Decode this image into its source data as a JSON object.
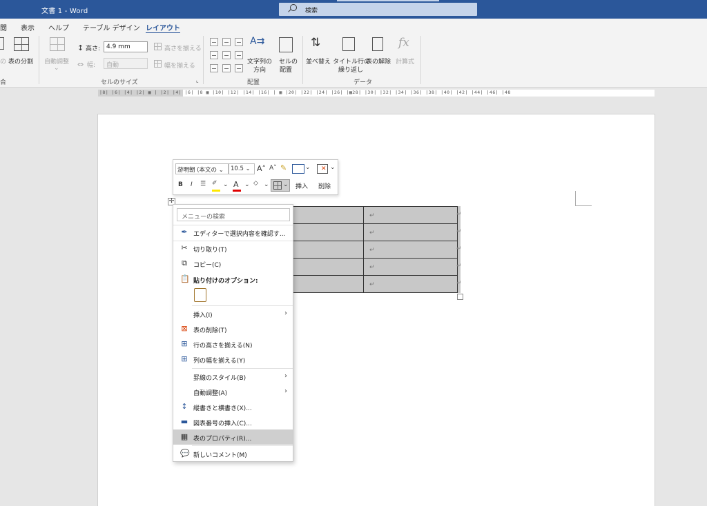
{
  "titlebar": {
    "doc_title": "文書 1  -  Word",
    "search_placeholder": "検索"
  },
  "tabs": [
    "閲",
    "表示",
    "ヘルプ",
    "テーブル デザイン",
    "レイアウト"
  ],
  "ribbon": {
    "partial_left_label": "の",
    "split_table": "表の分割",
    "autofit": "自動調整",
    "height_label": "高さ:",
    "height_value": "4.9 mm",
    "width_label": "幅:",
    "width_value": "自動",
    "distribute_rows": "高さを揃える",
    "distribute_cols": "幅を揃える",
    "text_direction_1": "文字列の",
    "text_direction_2": "方向",
    "cell_margins_1": "セルの",
    "cell_margins_2": "配置",
    "sort": "並べ替え",
    "repeat_header_1": "タイトル行の",
    "repeat_header_2": "繰り返し",
    "convert_to_text": "表の解除",
    "formula": "計算式",
    "group_merge": "合",
    "group_cell_size": "セルのサイズ",
    "group_alignment": "配置",
    "group_data": "データ"
  },
  "ruler": {
    "numbers": "|8| |6| |4| |2| ▦ | |2| |4| |6| |8 ▦ |10| |12| |14| |16| | ▦ |20| |22| |24| |26| |▦28| |30| |32| |34| |36| |38| |40| |42| |44| |46| |48"
  },
  "table": {
    "rows": 5,
    "return_mark": "↵"
  },
  "minibar": {
    "font_name": "游明朝 (本文の",
    "font_size": "10.5",
    "grow": "A",
    "shrink": "A",
    "bold": "B",
    "italic": "I",
    "insert": "挿入",
    "delete": "削除"
  },
  "context_menu": {
    "search_placeholder": "メニューの検索",
    "items": [
      {
        "label": "エディターで選択内容を確認す...",
        "icon": "editor-pen-icon"
      },
      {
        "label": "切り取り(T)",
        "icon": "scissors-icon"
      },
      {
        "label": "コピー(C)",
        "icon": "copy-icon"
      },
      {
        "label": "貼り付けのオプション:",
        "icon": "clipboard-icon"
      },
      {
        "label": "挿入(I)",
        "icon": ""
      },
      {
        "label": "表の削除(T)",
        "icon": "delete-table-icon"
      },
      {
        "label": "行の高さを揃える(N)",
        "icon": "distribute-rows-icon"
      },
      {
        "label": "列の幅を揃える(Y)",
        "icon": "distribute-columns-icon"
      },
      {
        "label": "罫線のスタイル(B)",
        "icon": ""
      },
      {
        "label": "自動調整(A)",
        "icon": ""
      },
      {
        "label": "縦書きと横書き(X)...",
        "icon": "text-direction-icon"
      },
      {
        "label": "図表番号の挿入(C)...",
        "icon": "caption-icon"
      },
      {
        "label": "表のプロパティ(R)...",
        "icon": "table-properties-icon"
      },
      {
        "label": "新しいコメント(M)",
        "icon": "comment-icon"
      }
    ]
  },
  "colors": {
    "accent": "#2b579a",
    "table_fill": "#c8c8c8",
    "highlight": "#cfcfcf"
  }
}
